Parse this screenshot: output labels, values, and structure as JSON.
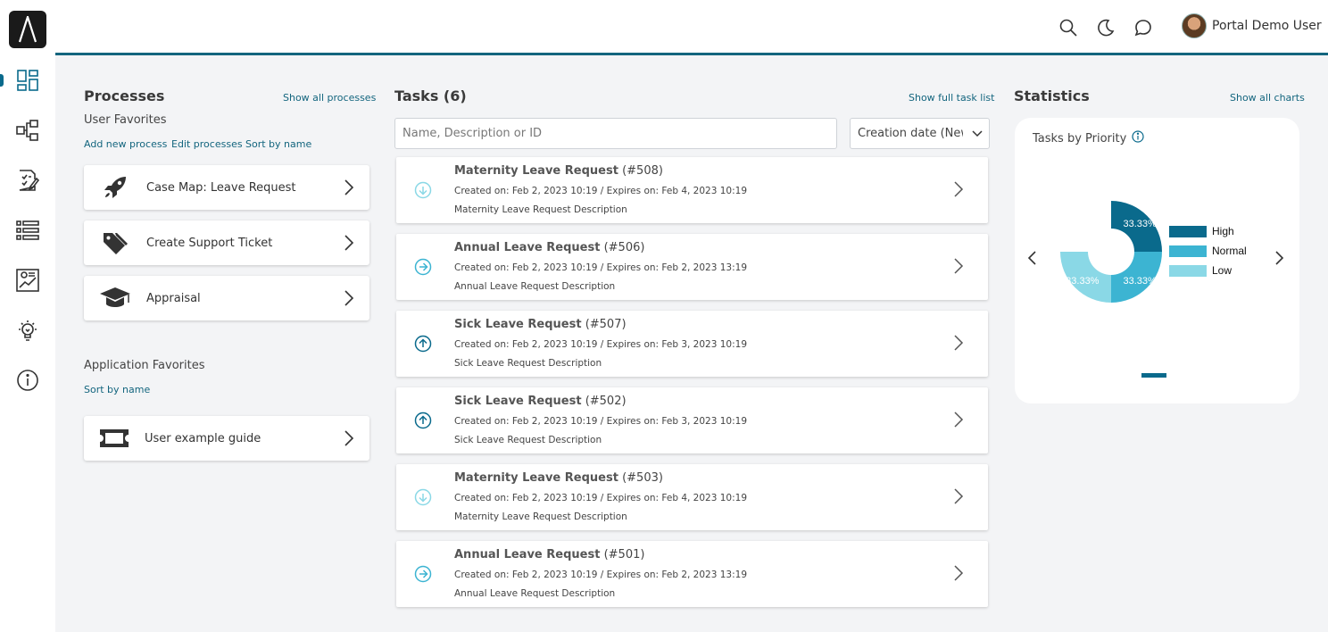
{
  "header": {
    "user_name": "Portal Demo User",
    "icons": [
      "search-icon",
      "moon-icon",
      "chat-icon"
    ]
  },
  "rail": {
    "items": [
      "dashboard-icon",
      "process-icon",
      "tasks-icon",
      "list-icon",
      "statistics-icon",
      "idea-icon",
      "info-icon"
    ]
  },
  "processes": {
    "title": "Processes",
    "show_all": "Show all processes",
    "user_favorites": "User Favorites",
    "add_new": "Add new process",
    "edit": "Edit processes",
    "sort": "Sort by name",
    "items": [
      {
        "label": "Case Map: Leave Request",
        "icon": "rocket-icon"
      },
      {
        "label": "Create Support Ticket",
        "icon": "tags-icon"
      },
      {
        "label": "Appraisal",
        "icon": "graduation-cap-icon"
      }
    ],
    "app_favorites": "Application Favorites",
    "app_sort": "Sort by name",
    "app_items": [
      {
        "label": "User example guide",
        "icon": "ticket-icon"
      }
    ]
  },
  "tasks": {
    "title": "Tasks (6)",
    "show_full": "Show full task list",
    "search_placeholder": "Name, Description or ID",
    "sort_value": "Creation date (Newest first)",
    "items": [
      {
        "name": "Maternity Leave Request",
        "id": "(#508)",
        "meta": "Created on: Feb 2, 2023 10:19 / Expires on: Feb 4, 2023 10:19",
        "desc": "Maternity Leave Request Description",
        "priority": "low"
      },
      {
        "name": "Annual Leave Request",
        "id": "(#506)",
        "meta": "Created on: Feb 2, 2023 10:19 / Expires on: Feb 2, 2023 13:19",
        "desc": "Annual Leave Request Description",
        "priority": "normal"
      },
      {
        "name": "Sick Leave Request",
        "id": "(#507)",
        "meta": "Created on: Feb 2, 2023 10:19 / Expires on: Feb 3, 2023 10:19",
        "desc": "Sick Leave Request Description",
        "priority": "high"
      },
      {
        "name": "Sick Leave Request",
        "id": "(#502)",
        "meta": "Created on: Feb 2, 2023 10:19 / Expires on: Feb 3, 2023 10:19",
        "desc": "Sick Leave Request Description",
        "priority": "high"
      },
      {
        "name": "Maternity Leave Request",
        "id": "(#503)",
        "meta": "Created on: Feb 2, 2023 10:19 / Expires on: Feb 4, 2023 10:19",
        "desc": "Maternity Leave Request Description",
        "priority": "low"
      },
      {
        "name": "Annual Leave Request",
        "id": "(#501)",
        "meta": "Created on: Feb 2, 2023 10:19 / Expires on: Feb 2, 2023 13:19",
        "desc": "Annual Leave Request Description",
        "priority": "normal"
      }
    ]
  },
  "statistics": {
    "title": "Statistics",
    "show_all": "Show all charts",
    "chart_title": "Tasks by Priority"
  },
  "colors": {
    "high": "#0a6a8c",
    "normal": "#3cb4d2",
    "low": "#8ad8e6",
    "accent": "#13657e"
  },
  "chart_data": {
    "type": "pie",
    "title": "Tasks by Priority",
    "categories": [
      "High",
      "Normal",
      "Low"
    ],
    "values": [
      33.33,
      33.33,
      33.33
    ],
    "labels": [
      "33.33%",
      "33.33%",
      "33.33%"
    ],
    "legend": "right"
  }
}
